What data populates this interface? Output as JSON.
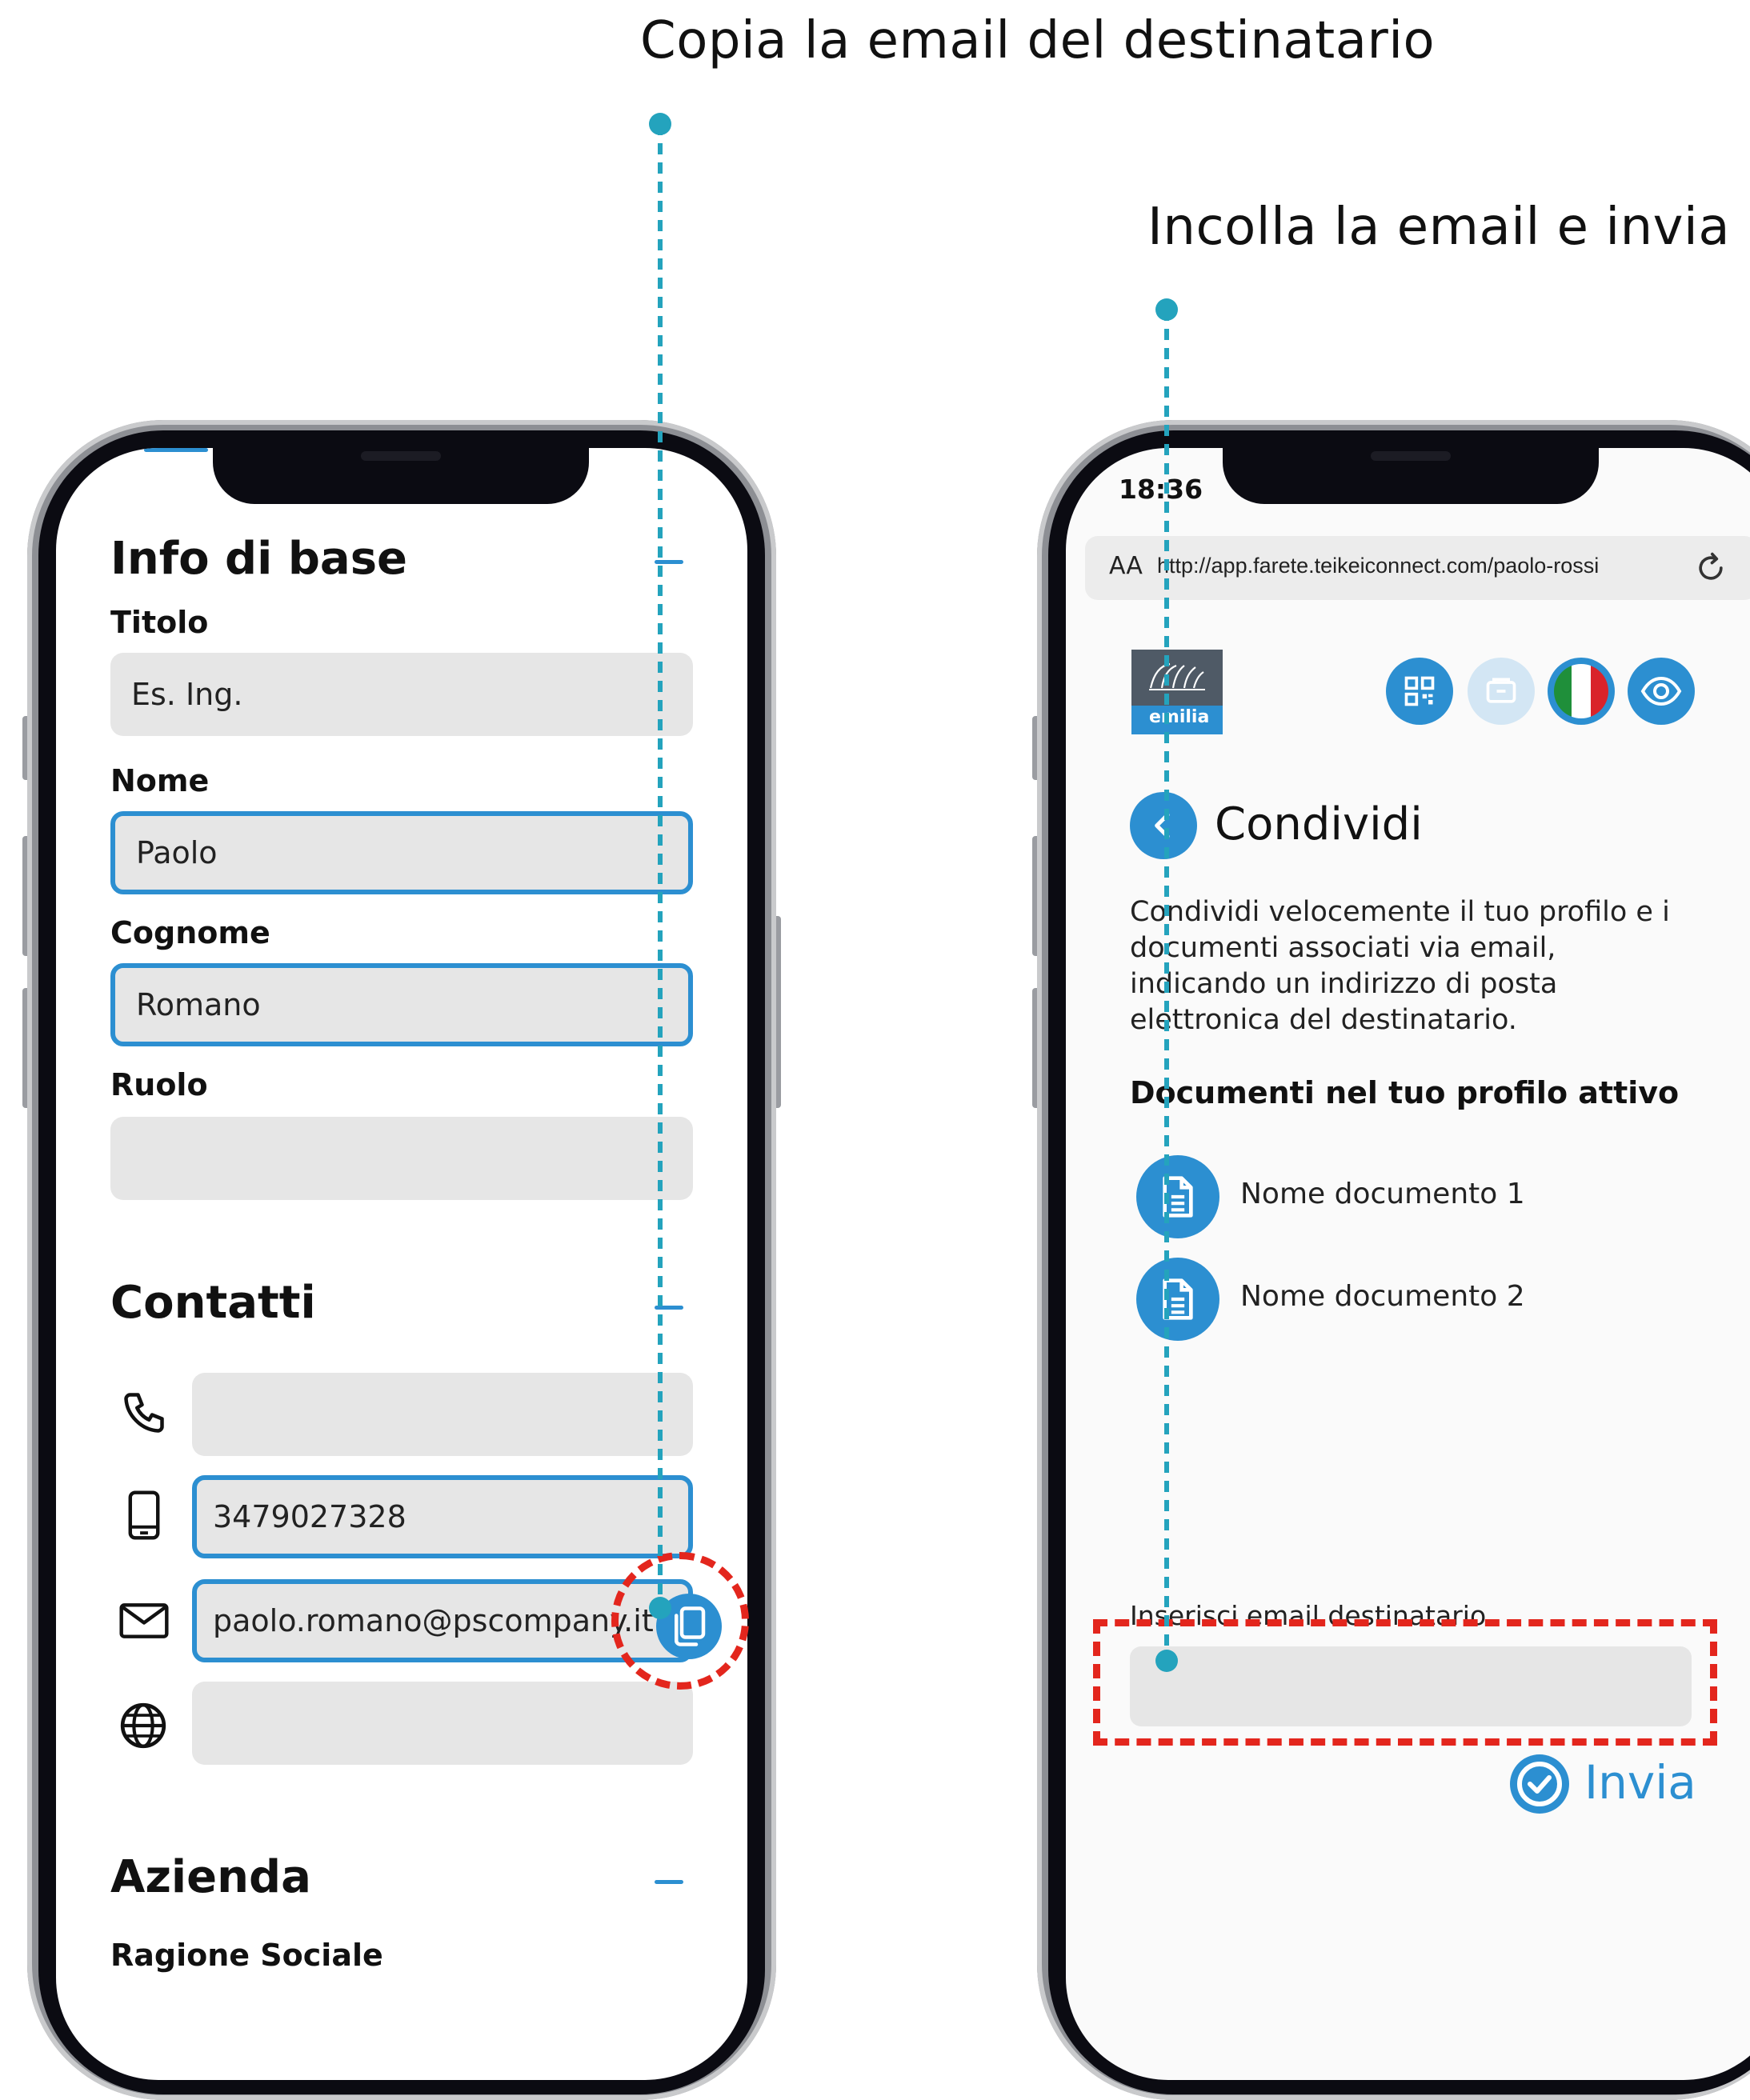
{
  "captions": {
    "copy": "Copia la email del destinatario",
    "paste": "Incolla la email e invia"
  },
  "left_phone": {
    "info": {
      "title": "Info di base",
      "titolo_label": "Titolo",
      "titolo_value": "Es. Ing.",
      "nome_label": "Nome",
      "nome_value": "Paolo",
      "cognome_label": "Cognome",
      "cognome_value": "Romano",
      "ruolo_label": "Ruolo",
      "ruolo_value": ""
    },
    "contatti": {
      "title": "Contatti",
      "phone_value": "",
      "mobile_value": "3479027328",
      "email_value": "paolo.romano@pscompany.it",
      "web_value": ""
    },
    "azienda": {
      "title": "Azienda",
      "ragione_label": "Ragione Sociale"
    }
  },
  "right_phone": {
    "status": {
      "time": "18:36"
    },
    "browser": {
      "text_size": "AA",
      "url": "http://app.farete.teikeiconnect.com/paolo-rossi"
    },
    "logo": {
      "text": "emilia"
    },
    "page": {
      "title": "Condividi",
      "description": [
        "Condividi velocemente il tuo profilo e i",
        "documenti associati via email,",
        "indicando un indirizzo di posta",
        "elettronica del destinatario."
      ],
      "docs_heading": "Documenti nel tuo profilo attivo",
      "documents": [
        "Nome documento 1",
        "Nome documento 2"
      ],
      "email_label": "Inserisci email destinatario",
      "email_value": "",
      "send_label": "Invia"
    }
  },
  "colors": {
    "accent": "#2c8fd1",
    "guide": "#24a3bd",
    "highlight": "#e3261d"
  }
}
